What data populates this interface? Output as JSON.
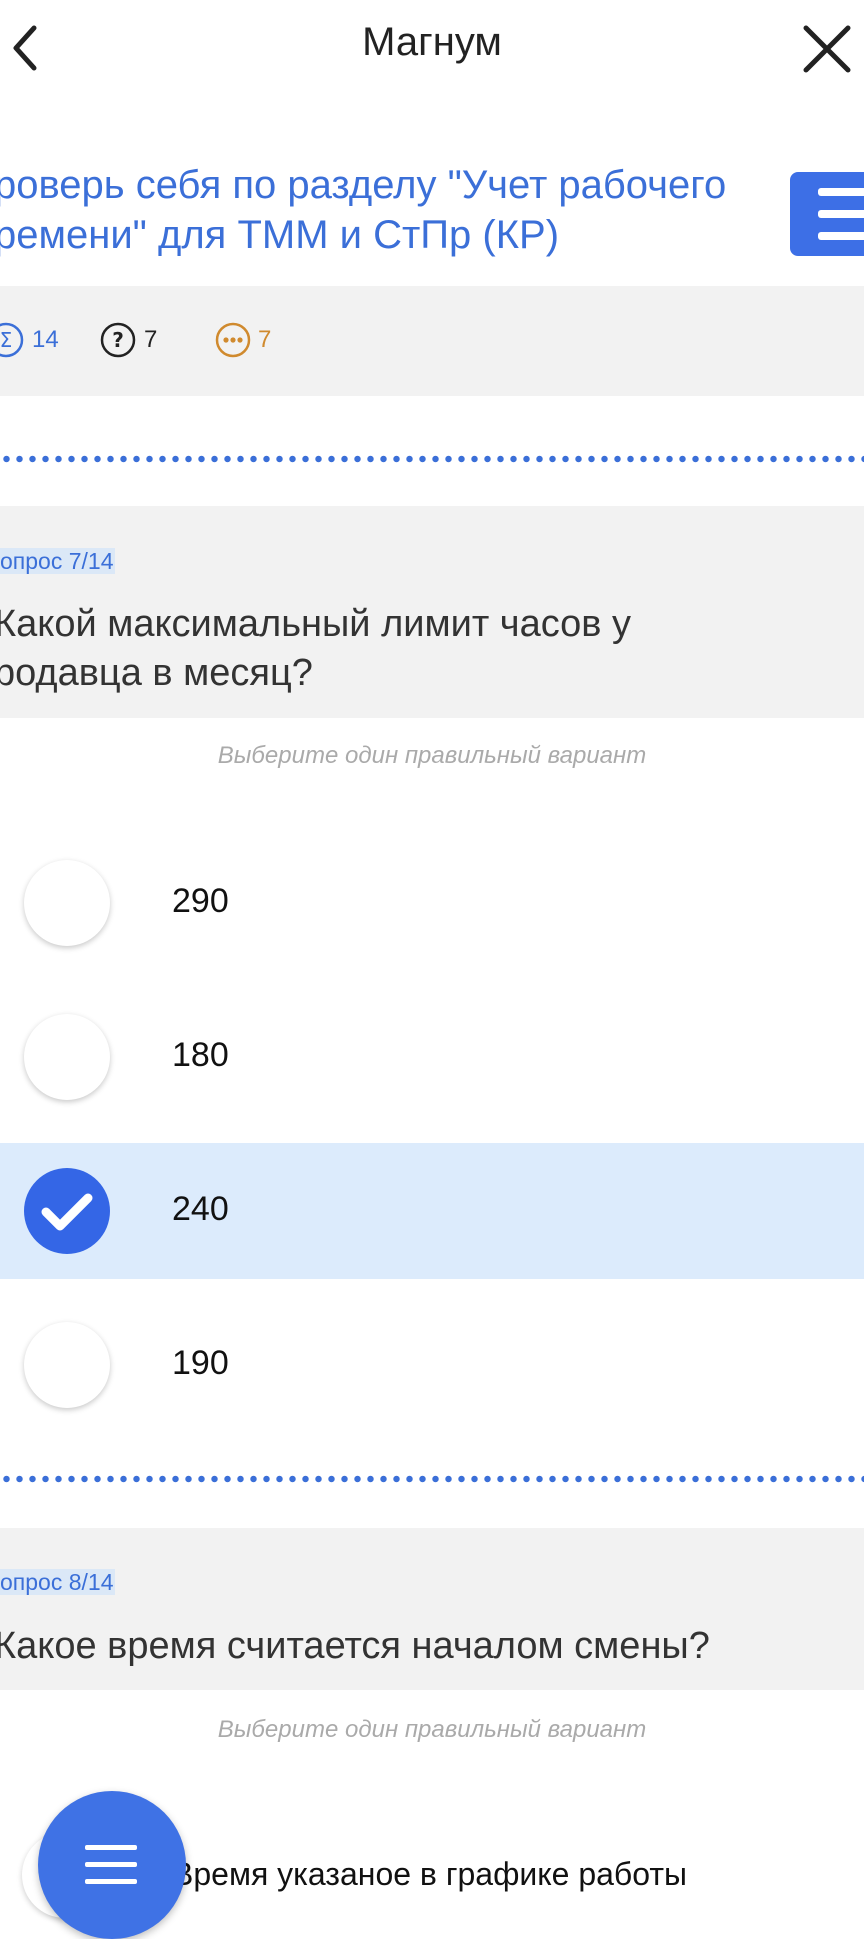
{
  "header": {
    "title": "Магнум",
    "back_icon": "chevron-left-icon",
    "close_icon": "close-icon"
  },
  "quiz": {
    "title_line1": "роверь себя по разделу \"Учет рабочего",
    "title_line2": "ремени\" для ТММ и СтПр (КР)",
    "menu_icon": "menu-icon"
  },
  "stats": {
    "total": "14",
    "unanswered": "7",
    "pending": "7"
  },
  "questions": [
    {
      "number": "опрос 7/14",
      "text_line1": "Какой максимальный лимит часов у",
      "text_line2": "родавца в месяц?",
      "hint": "Выберите один правильный вариант",
      "options": [
        {
          "label": "290",
          "selected": false
        },
        {
          "label": "180",
          "selected": false
        },
        {
          "label": "240",
          "selected": true
        },
        {
          "label": "190",
          "selected": false
        }
      ]
    },
    {
      "number": "опрос 8/14",
      "text_line1": "Какое время считается началом смены?",
      "hint": "Выберите один правильный вариант",
      "options": [
        {
          "label": "Время указаное в графике работы",
          "selected": false
        }
      ]
    }
  ],
  "colors": {
    "accent": "#3b6fd8",
    "button": "#3d6fe6",
    "selected_bg": "#dcebfc",
    "pending": "#d08a2e"
  }
}
